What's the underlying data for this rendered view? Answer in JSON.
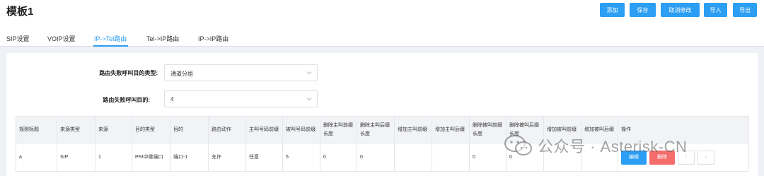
{
  "header": {
    "title": "模板1",
    "buttons": {
      "add": "添加",
      "save": "保存",
      "cancel": "取消修改",
      "import": "导入",
      "export": "导出"
    }
  },
  "tabs": [
    {
      "label": "SIP设置"
    },
    {
      "label": "VOIP设置"
    },
    {
      "label": "IP->Tel路由",
      "active": true
    },
    {
      "label": "Tel->IP路由"
    },
    {
      "label": "IP->IP路由"
    }
  ],
  "form": {
    "fail_type_label": "路由失败呼叫目的类型:",
    "fail_type_value": "通道分组",
    "fail_target_label": "路由失败呼叫目的:",
    "fail_target_value": "4"
  },
  "table": {
    "headers": [
      "规则标题",
      "来源类型",
      "来源",
      "目的类型",
      "目的",
      "路由动作",
      "主叫号码前缀",
      "被叫号码前缀",
      "删除主叫前缀长度",
      "删除主叫后缀长度",
      "增加主叫前缀",
      "增加主叫后缀",
      "删除被叫前缀长度",
      "删除被叫后缀长度",
      "增加被叫前缀",
      "增加被叫后缀",
      "操作"
    ],
    "rows": [
      [
        "a",
        "SIP",
        "1",
        "PRI中继端口",
        "端口-1",
        "允许",
        "任意",
        "5",
        "0",
        "0",
        "",
        "",
        "0",
        "0",
        "",
        ""
      ]
    ],
    "actions": {
      "edit": "编辑",
      "delete": "删除",
      "up": "↑",
      "down": "↓"
    }
  },
  "watermark": {
    "text": "公众号 · Asterisk-CN"
  },
  "colors": {
    "accent": "#2c9ef3",
    "danger": "#f56c6c"
  }
}
